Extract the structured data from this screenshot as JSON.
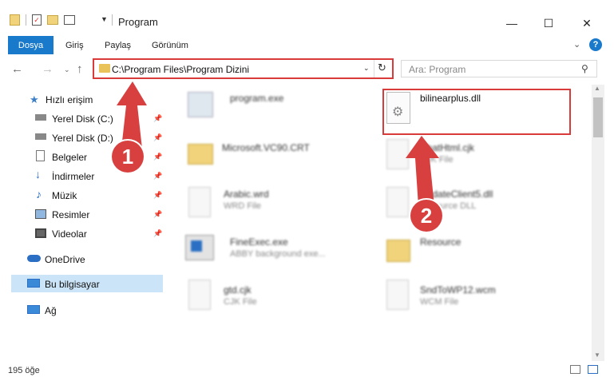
{
  "window": {
    "title": "Program",
    "minimize": "—",
    "maximize": "☐",
    "close": "✕"
  },
  "ribbon": {
    "file_tab": "Dosya",
    "tabs": [
      "Giriş",
      "Paylaş",
      "Görünüm"
    ],
    "help": "?"
  },
  "address": {
    "path": "C:\\Program Files\\Program Dizini",
    "search_placeholder": "Ara: Program"
  },
  "nav": {
    "quick_access": "Hızlı erişim",
    "items": [
      {
        "label": "Yerel Disk (C:)",
        "icon": "drive-icon"
      },
      {
        "label": "Yerel Disk (D:)",
        "icon": "drive-icon"
      },
      {
        "label": "Belgeler",
        "icon": "documents-icon"
      },
      {
        "label": "İndirmeler",
        "icon": "download-icon"
      },
      {
        "label": "Müzik",
        "icon": "music-icon"
      },
      {
        "label": "Resimler",
        "icon": "pictures-icon"
      },
      {
        "label": "Videolar",
        "icon": "videos-icon"
      }
    ],
    "onedrive": "OneDrive",
    "this_pc": "Bu bilgisayar",
    "network": "Ağ"
  },
  "files": {
    "left": [
      {
        "name": "program.exe",
        "type": ""
      },
      {
        "name": "Microsoft.VC90.CRT",
        "type": ""
      },
      {
        "name": "Arabic.wrd",
        "type": "WRD File"
      },
      {
        "name": "FineExec.exe",
        "type": "ABBY background exe..."
      },
      {
        "name": "gtd.cjk",
        "type": "CJK File"
      }
    ],
    "right": [
      {
        "name": "bilinearplus.dll",
        "type": ""
      },
      {
        "name": "ChatHtml.cjk",
        "type": "CJK File"
      },
      {
        "name": "UpdateClient5.dll",
        "type": "Resource DLL"
      },
      {
        "name": "Resource",
        "type": ""
      },
      {
        "name": "SndToWP12.wcm",
        "type": "WCM File"
      }
    ]
  },
  "status": {
    "count": "195 öğe"
  },
  "callouts": [
    "1",
    "2"
  ],
  "colors": {
    "accent": "#1979ca",
    "highlight": "#d93a3a",
    "callout": "#d84040",
    "selected": "#cce4f7"
  }
}
